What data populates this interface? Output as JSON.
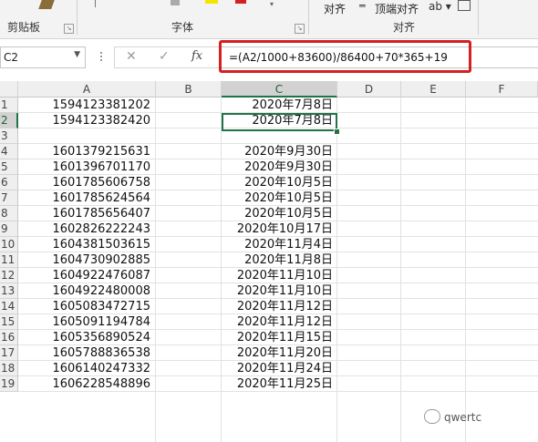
{
  "ribbon": {
    "clipboard_label": "剪贴板",
    "font_label": "字体",
    "align_text_1": "对齐",
    "align_text_2": "顶端对齐",
    "align_label": "对齐"
  },
  "formula_bar": {
    "name_box": "C2",
    "cancel_icon": "✕",
    "enter_icon": "✓",
    "fx_label": "fx",
    "formula": "=(A2/1000+83600)/86400+70*365+19"
  },
  "columns": [
    "A",
    "B",
    "C",
    "D",
    "E",
    "F"
  ],
  "rows": [
    {
      "num": "1",
      "a": "1594123381202",
      "c": "2020年7月8日"
    },
    {
      "num": "2",
      "a": "1594123382420",
      "c": "2020年7月8日"
    },
    {
      "num": "3",
      "a": "",
      "c": ""
    },
    {
      "num": "4",
      "a": "1601379215631",
      "c": "2020年9月30日"
    },
    {
      "num": "5",
      "a": "1601396701170",
      "c": "2020年9月30日"
    },
    {
      "num": "6",
      "a": "1601785606758",
      "c": "2020年10月5日"
    },
    {
      "num": "7",
      "a": "1601785624564",
      "c": "2020年10月5日"
    },
    {
      "num": "8",
      "a": "1601785656407",
      "c": "2020年10月5日"
    },
    {
      "num": "9",
      "a": "1602826222243",
      "c": "2020年10月17日"
    },
    {
      "num": "10",
      "a": "1604381503615",
      "c": "2020年11月4日"
    },
    {
      "num": "11",
      "a": "1604730902885",
      "c": "2020年11月8日"
    },
    {
      "num": "12",
      "a": "1604922476087",
      "c": "2020年11月10日"
    },
    {
      "num": "13",
      "a": "1604922480008",
      "c": "2020年11月10日"
    },
    {
      "num": "14",
      "a": "1605083472715",
      "c": "2020年11月12日"
    },
    {
      "num": "15",
      "a": "1605091194784",
      "c": "2020年11月12日"
    },
    {
      "num": "16",
      "a": "1605356890524",
      "c": "2020年11月15日"
    },
    {
      "num": "17",
      "a": "1605788836538",
      "c": "2020年11月20日"
    },
    {
      "num": "18",
      "a": "1606140247332",
      "c": "2020年11月24日"
    },
    {
      "num": "19",
      "a": "1606228548896",
      "c": "2020年11月25日"
    }
  ],
  "watermark": "qwertc",
  "colors": {
    "accent": "#217346",
    "highlight": "#d42020"
  }
}
